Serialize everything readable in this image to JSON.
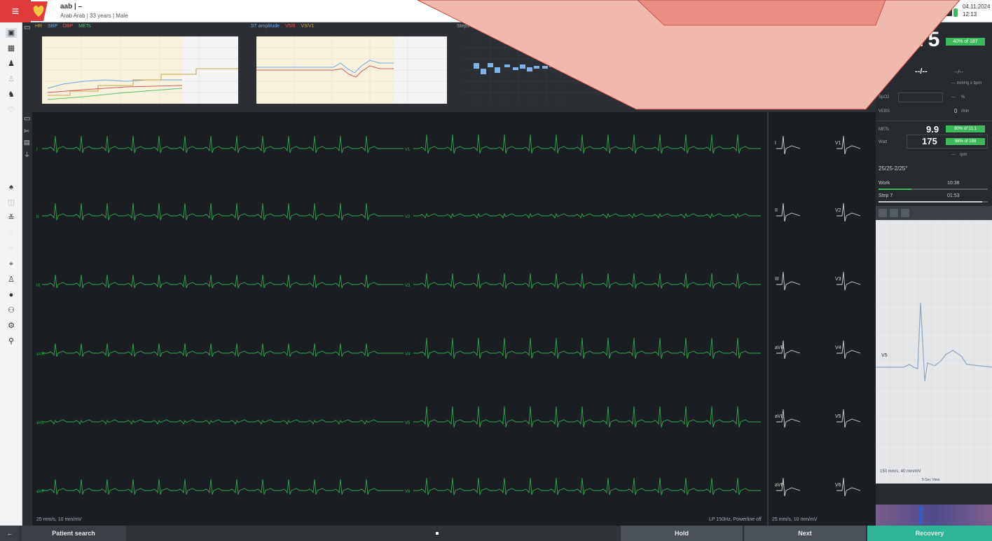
{
  "header": {
    "menu_glyph": "≡",
    "patient_name": "aab | –",
    "patient_info": "Arab Arab | 33 years | Male",
    "date": "04.11.2024",
    "time": "12:13"
  },
  "left_icons": [
    "monitor-icon",
    "calendar-icon",
    "person-icon",
    "walk-icon",
    "runner-icon",
    "heart-icon",
    "record-icon",
    "bike-icon",
    "grid-icon",
    "anchor-icon",
    "person-alert-icon",
    "dimmed-a-icon",
    "stairs-icon",
    "dimmed-b-icon",
    "dimmed-c-icon",
    "cursor-icon",
    "figure-icon",
    "info-icon",
    "biker-icon",
    "treadmill-icon",
    "man-icon"
  ],
  "trend": {
    "chart1_legend": [
      "HR",
      "SBP",
      "DBP",
      "METs"
    ],
    "chart2_legend": [
      "ST amplitude",
      "V5/II",
      "V3/V1"
    ],
    "chart3_legend": [
      "Steps"
    ]
  },
  "ecg": {
    "leads_left": [
      "I",
      "II",
      "III",
      "aVR",
      "aVL",
      "aVF"
    ],
    "leads_mid": [
      "V1",
      "V2",
      "V3",
      "V4",
      "V5",
      "V6"
    ],
    "median_left": [
      "I",
      "II",
      "III",
      "aVR",
      "aVL",
      "aVF"
    ],
    "median_right": [
      "V1",
      "V2",
      "V3",
      "V4",
      "V5",
      "V6"
    ],
    "speed_left": "25 mm/s, 10 mm/mV",
    "filter_info": "LP 150Hz, Powerline off",
    "speed_right": "25 mm/s, 10 mm/mV"
  },
  "right": {
    "hr_value": "75",
    "hr_percent": "40% of 187",
    "bp_value": "--/--",
    "bp_units": "--/--",
    "bp_sub": "--- mmHg x bpm",
    "spo2_label": "SpO2",
    "spo2_value": "---",
    "spo2_unit": "%",
    "vebs_label": "VEBS",
    "vebs_value": "0",
    "vebs_unit": "/min",
    "mets_label": "METs",
    "mets_value": "9.9",
    "mets_percent": "80% of 11.1",
    "watt_label": "Watt",
    "watt_value": "175",
    "watt_percent": "98% of 198",
    "rpm_value": "---",
    "rpm_unit": "rpm",
    "protocol": "25/25-2/25°",
    "work_label": "Work",
    "work_time": "10:38",
    "step_label": "Step 7",
    "step_time": "01:53",
    "work_progress": 0.3,
    "step_progress": 0.95,
    "zoom_lead": "V5",
    "zoom_speed": "150 mm/s, 40 mm/mV",
    "zoom_caption": "5-Sec View"
  },
  "footer": {
    "back_glyph": "←",
    "patient_search": "Patient search",
    "hold": "Hold",
    "next": "Next",
    "recovery": "Recovery"
  },
  "colors": {
    "accent_green": "#3cb95a",
    "ecg_green": "#2fa84a",
    "recovery": "#2fb596",
    "overlay": "#f0b9b0"
  }
}
